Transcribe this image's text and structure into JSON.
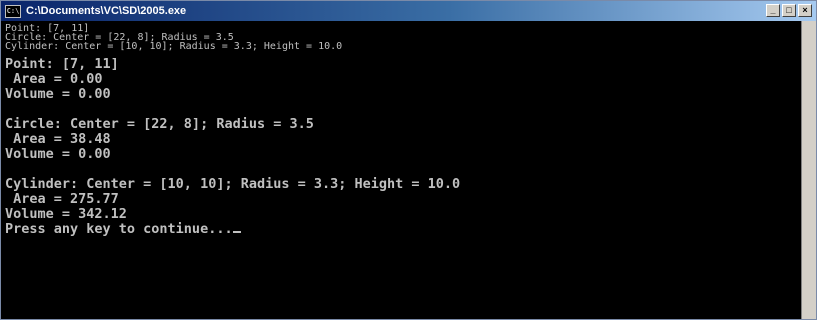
{
  "window": {
    "title": "C:\\Documents\\VC\\SD\\2005.exe",
    "icon_label": "C:\\",
    "controls": {
      "minimize": "_",
      "maximize": "□",
      "close": "×"
    }
  },
  "console": {
    "header_lines": [
      "Point: [7, 11]",
      "Circle: Center = [22, 8]; Radius = 3.5",
      "Cylinder: Center = [10, 10]; Radius = 3.3; Height = 10.0"
    ],
    "point": {
      "label": "Point: [7, 11]",
      "area": " Area = 0.00",
      "volume": "Volume = 0.00"
    },
    "circle": {
      "label": "Circle: Center = [22, 8]; Radius = 3.5",
      "area": " Area = 38.48",
      "volume": "Volume = 0.00"
    },
    "cylinder": {
      "label": "Cylinder: Center = [10, 10]; Radius = 3.3; Height = 10.0",
      "area": " Area = 275.77",
      "volume": "Volume = 342.12"
    },
    "prompt": "Press any key to continue..."
  }
}
